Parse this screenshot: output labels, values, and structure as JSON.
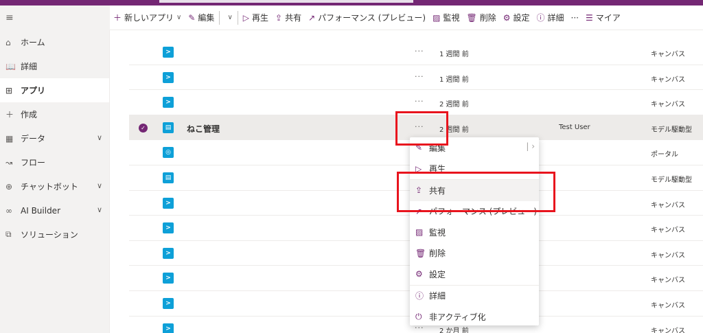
{
  "command_bar": {
    "items": [
      {
        "icon": "＋",
        "label": "新しいアプリ",
        "chevron": "∨"
      },
      {
        "icon": "✎",
        "label": "編集"
      },
      {
        "icon": "∨",
        "label": ""
      },
      {
        "icon": "▷",
        "label": "再生"
      },
      {
        "icon": "⇪",
        "label": "共有"
      },
      {
        "icon": "↗",
        "label": "パフォーマンス (プレビュー)"
      },
      {
        "icon": "▨",
        "label": "監視"
      },
      {
        "icon": "🗑",
        "label": "削除"
      },
      {
        "icon": "⚙",
        "label": "設定"
      },
      {
        "icon": "ⓘ",
        "label": "詳細"
      },
      {
        "icon": "",
        "label": "···"
      },
      {
        "icon": "☰",
        "label": "マイア"
      }
    ]
  },
  "sidebar": {
    "hamburger_icon": "≡",
    "items": [
      {
        "icon": "⌂",
        "label": "ホーム",
        "chevron": ""
      },
      {
        "icon": "📖",
        "label": "詳細",
        "chevron": ""
      },
      {
        "icon": "⊞",
        "label": "アプリ",
        "chevron": ""
      },
      {
        "icon": "＋",
        "label": "作成",
        "chevron": ""
      },
      {
        "icon": "▦",
        "label": "データ",
        "chevron": "∨"
      },
      {
        "icon": "↝",
        "label": "フロー",
        "chevron": ""
      },
      {
        "icon": "⊕",
        "label": "チャットボット",
        "chevron": "∨"
      },
      {
        "icon": "∞",
        "label": "AI Builder",
        "chevron": "∨"
      },
      {
        "icon": "⧉",
        "label": "ソリューション",
        "chevron": ""
      }
    ]
  },
  "grid": {
    "rows": [
      {
        "icon": ">",
        "name": "",
        "modified": "1 週間 前",
        "owner": "",
        "type": "キャンバス",
        "selected": false
      },
      {
        "icon": ">",
        "name": "",
        "modified": "1 週間 前",
        "owner": "",
        "type": "キャンバス",
        "selected": false
      },
      {
        "icon": ">",
        "name": "",
        "modified": "2 週間 前",
        "owner": "",
        "type": "キャンバス",
        "selected": false
      },
      {
        "icon": "▤",
        "name": "ねこ管理",
        "modified": "2 週間 前",
        "owner": "Test User",
        "type": "モデル駆動型",
        "selected": true
      },
      {
        "icon": "◎",
        "name": "",
        "modified": "",
        "owner": "",
        "type": "ポータル",
        "selected": false
      },
      {
        "icon": "▤",
        "name": "",
        "modified": "",
        "owner": "",
        "type": "モデル駆動型",
        "selected": false
      },
      {
        "icon": ">",
        "name": "",
        "modified": "",
        "owner": "",
        "type": "キャンバス",
        "selected": false
      },
      {
        "icon": ">",
        "name": "",
        "modified": "",
        "owner": "",
        "type": "キャンバス",
        "selected": false
      },
      {
        "icon": ">",
        "name": "",
        "modified": "",
        "owner": "",
        "type": "キャンバス",
        "selected": false
      },
      {
        "icon": ">",
        "name": "",
        "modified": "",
        "owner": "",
        "type": "キャンバス",
        "selected": false
      },
      {
        "icon": ">",
        "name": "",
        "modified": "",
        "owner": "",
        "type": "キャンバス",
        "selected": false
      },
      {
        "icon": ">",
        "name": "",
        "modified": "2 か月 前",
        "owner": "",
        "type": "キャンバス",
        "selected": false
      }
    ],
    "dots": "···",
    "check": "✓"
  },
  "context_menu": {
    "items": [
      {
        "icon": "✎",
        "label": "編集",
        "split": "| ›"
      },
      {
        "icon": "▷",
        "label": "再生"
      },
      {
        "icon": "⇪",
        "label": "共有"
      },
      {
        "icon": "↗",
        "label": "パフォーマンス (プレビュー)"
      },
      {
        "icon": "▨",
        "label": "監視"
      },
      {
        "icon": "🗑",
        "label": "削除"
      },
      {
        "icon": "⚙",
        "label": "設定"
      },
      {
        "icon": "ⓘ",
        "label": "詳細"
      },
      {
        "icon": "⏻",
        "label": "非アクティブ化"
      }
    ]
  },
  "colors": {
    "accent": "#742774",
    "app_icon": "#0ea0d8",
    "highlight": "#e8141d"
  }
}
